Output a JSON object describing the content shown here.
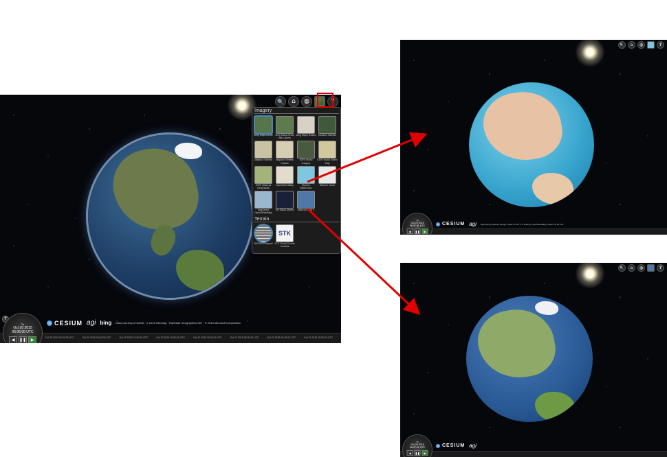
{
  "main_viewer": {
    "toolbar": {
      "search_glyph": "🔍",
      "home_glyph": "⌂",
      "scene_mode_glyph": "◍",
      "help_glyph": "?"
    },
    "picker": {
      "imagery_title": "Imagery",
      "imagery_items": [
        {
          "label": "Bing Maps Aerial",
          "color": "#56764a"
        },
        {
          "label": "Bing Maps Aerial with Labels",
          "color": "#5f7a4f"
        },
        {
          "label": "Bing Maps Roads",
          "color": "#d7d2c4"
        },
        {
          "label": "Mapbox Satellite",
          "color": "#3f5a3a"
        },
        {
          "label": "Mapbox Streets",
          "color": "#c9c3a3"
        },
        {
          "label": "Mapbox Streets Classic",
          "color": "#d6cdb3"
        },
        {
          "label": "ESRI World Imagery",
          "color": "#4a5a40"
        },
        {
          "label": "ESRI World Street Map",
          "color": "#d2c89e"
        },
        {
          "label": "ESRI National Geographic",
          "color": "#a3b47a"
        },
        {
          "label": "OpenStreetMap",
          "color": "#e2dccb"
        },
        {
          "label": "Stamen Watercolor",
          "color": "#7fc6de"
        },
        {
          "label": "Stamen Toner",
          "color": "#e8e8e8"
        },
        {
          "label": "MapQuest OpenStreetMap",
          "color": "#9bb7cf"
        },
        {
          "label": "The Black Marble",
          "color": "#1a1f3a"
        },
        {
          "label": "Natural Earth II",
          "color": "#4f78a8"
        }
      ],
      "terrain_title": "Terrain",
      "terrain_items": [
        {
          "label": "WGS84 Ellipsoid",
          "color": "#bbbbbb"
        },
        {
          "label": "STK World Terrain meshes",
          "color": "#f3f3f3"
        }
      ]
    },
    "clock": {
      "weekday": "Tu",
      "date": "Oct 20 2015",
      "time": "06:06:00 UTC"
    },
    "credits": {
      "cesium": "CESIUM",
      "agi": "agi",
      "bing": "bing",
      "data_attribution": "Data courtesy of NASA · © 2015 Intermap · Earthstar Geographics SIO · © 2015 Microsoft Corporation"
    },
    "timeline_ticks": [
      "Oct 20 2015 00:00:00 UTC",
      "Oct 20 2015 06:00:00 UTC",
      "Oct 20 2015 12:00:00 UTC",
      "Oct 20 2015 18:00:00 UTC",
      "Oct 21 2015 00:00:00 UTC",
      "Oct 21 2015 06:00:00 UTC",
      "Oct 21 2015 12:00:00 UTC",
      "Oct 21 2015 18:00:00 UTC"
    ]
  },
  "top_right_viewer": {
    "clock": {
      "weekday": "Tu",
      "date": "Oct 20 2015",
      "time": "06:07:51 UTC"
    },
    "credits": {
      "cesium": "CESIUM",
      "agi": "agi",
      "data_attribution": "Map tiles by Stamen Design, under CC BY 3.0. Data by OpenStreetMap, under CC BY SA."
    }
  },
  "bottom_right_viewer": {
    "clock": {
      "weekday": "Tu",
      "date": "Oct 20 2015",
      "time": "06:07:21 UTC"
    },
    "credits": {
      "cesium": "CESIUM",
      "agi": "agi"
    }
  },
  "colors": {
    "annotation_red": "#e00000",
    "space_bg": "#05070b"
  }
}
